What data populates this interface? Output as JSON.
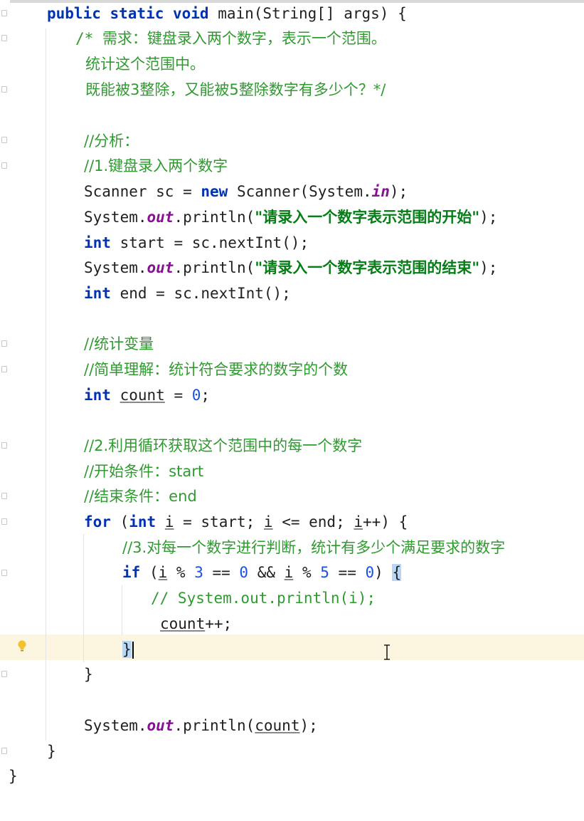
{
  "colors": {
    "keyword": "#0033b3",
    "field": "#871094",
    "string": "#067d17",
    "comment": "#2f9a2f",
    "number": "#1750eb",
    "current_line": "#fcf6e1"
  },
  "icons": [
    "lightbulb-icon",
    "text-cursor-icon"
  ],
  "code": {
    "l1": {
      "kw1": "public static void ",
      "rest": "main(String[] args) {"
    },
    "l2": {
      "a": "/* ",
      "b": "需求：键盘录入两个数字，表示一个范围。"
    },
    "l3": {
      "a": "统计这个范围中。"
    },
    "l4": {
      "a": "既能被3整除，又能被5整除数字有多少个？*/"
    },
    "l6": {
      "a": "//分析："
    },
    "l7": {
      "a": "//1.键盘录入两个数字"
    },
    "l8": {
      "a": "Scanner sc = ",
      "kw": "new",
      "b": " Scanner(System.",
      "f": "in",
      "c": ");"
    },
    "l9": {
      "a": "System.",
      "f": "out",
      "b": ".println(",
      "s": "\"请录入一个数字表示范围的开始\"",
      "c": ");"
    },
    "l10": {
      "kw": "int",
      "a": " start = sc.nextInt();"
    },
    "l11": {
      "a": "System.",
      "f": "out",
      "b": ".println(",
      "s": "\"请录入一个数字表示范围的结束\"",
      "c": ");"
    },
    "l12": {
      "kw": "int",
      "a": " end = sc.nextInt();"
    },
    "l14": {
      "a": "//统计变量"
    },
    "l15": {
      "a": "//简单理解：统计符合要求的数字的个数"
    },
    "l16": {
      "kw": "int",
      "sp": " ",
      "v": "count",
      "a": " = ",
      "n": "0",
      "b": ";"
    },
    "l18": {
      "a": "//2.利用循环获取这个范围中的每一个数字"
    },
    "l19": {
      "a": "//开始条件：start"
    },
    "l20": {
      "a": "//结束条件：end"
    },
    "l21": {
      "kw1": "for",
      "p1": " (",
      "kw2": "int",
      "sp": " ",
      "v1": "i",
      "a": " = start; ",
      "v2": "i",
      "b": " <= end; ",
      "v3": "i",
      "c": "++) {"
    },
    "l22": {
      "a": "//3.对每一个数字进行判断，统计有多少个满足要求的数字"
    },
    "l23": {
      "kw": "if",
      "p": " (",
      "v1": "i",
      "a": " % ",
      "n1": "3",
      "b": " == ",
      "n2": "0",
      "c": " && ",
      "v2": "i",
      "d": " % ",
      "n3": "5",
      "e": " == ",
      "n4": "0",
      "f": ") ",
      "br": "{"
    },
    "l24": {
      "a": "// System.out.println(i);"
    },
    "l25": {
      "v": "count",
      "a": "++;"
    },
    "l26": {
      "br": "}"
    },
    "l27": {
      "a": "}"
    },
    "l29": {
      "a": "System.",
      "f": "out",
      "b": ".println(",
      "v": "count",
      "c": ");"
    },
    "l30": {
      "a": "}"
    },
    "l31": {
      "a": "}"
    }
  }
}
